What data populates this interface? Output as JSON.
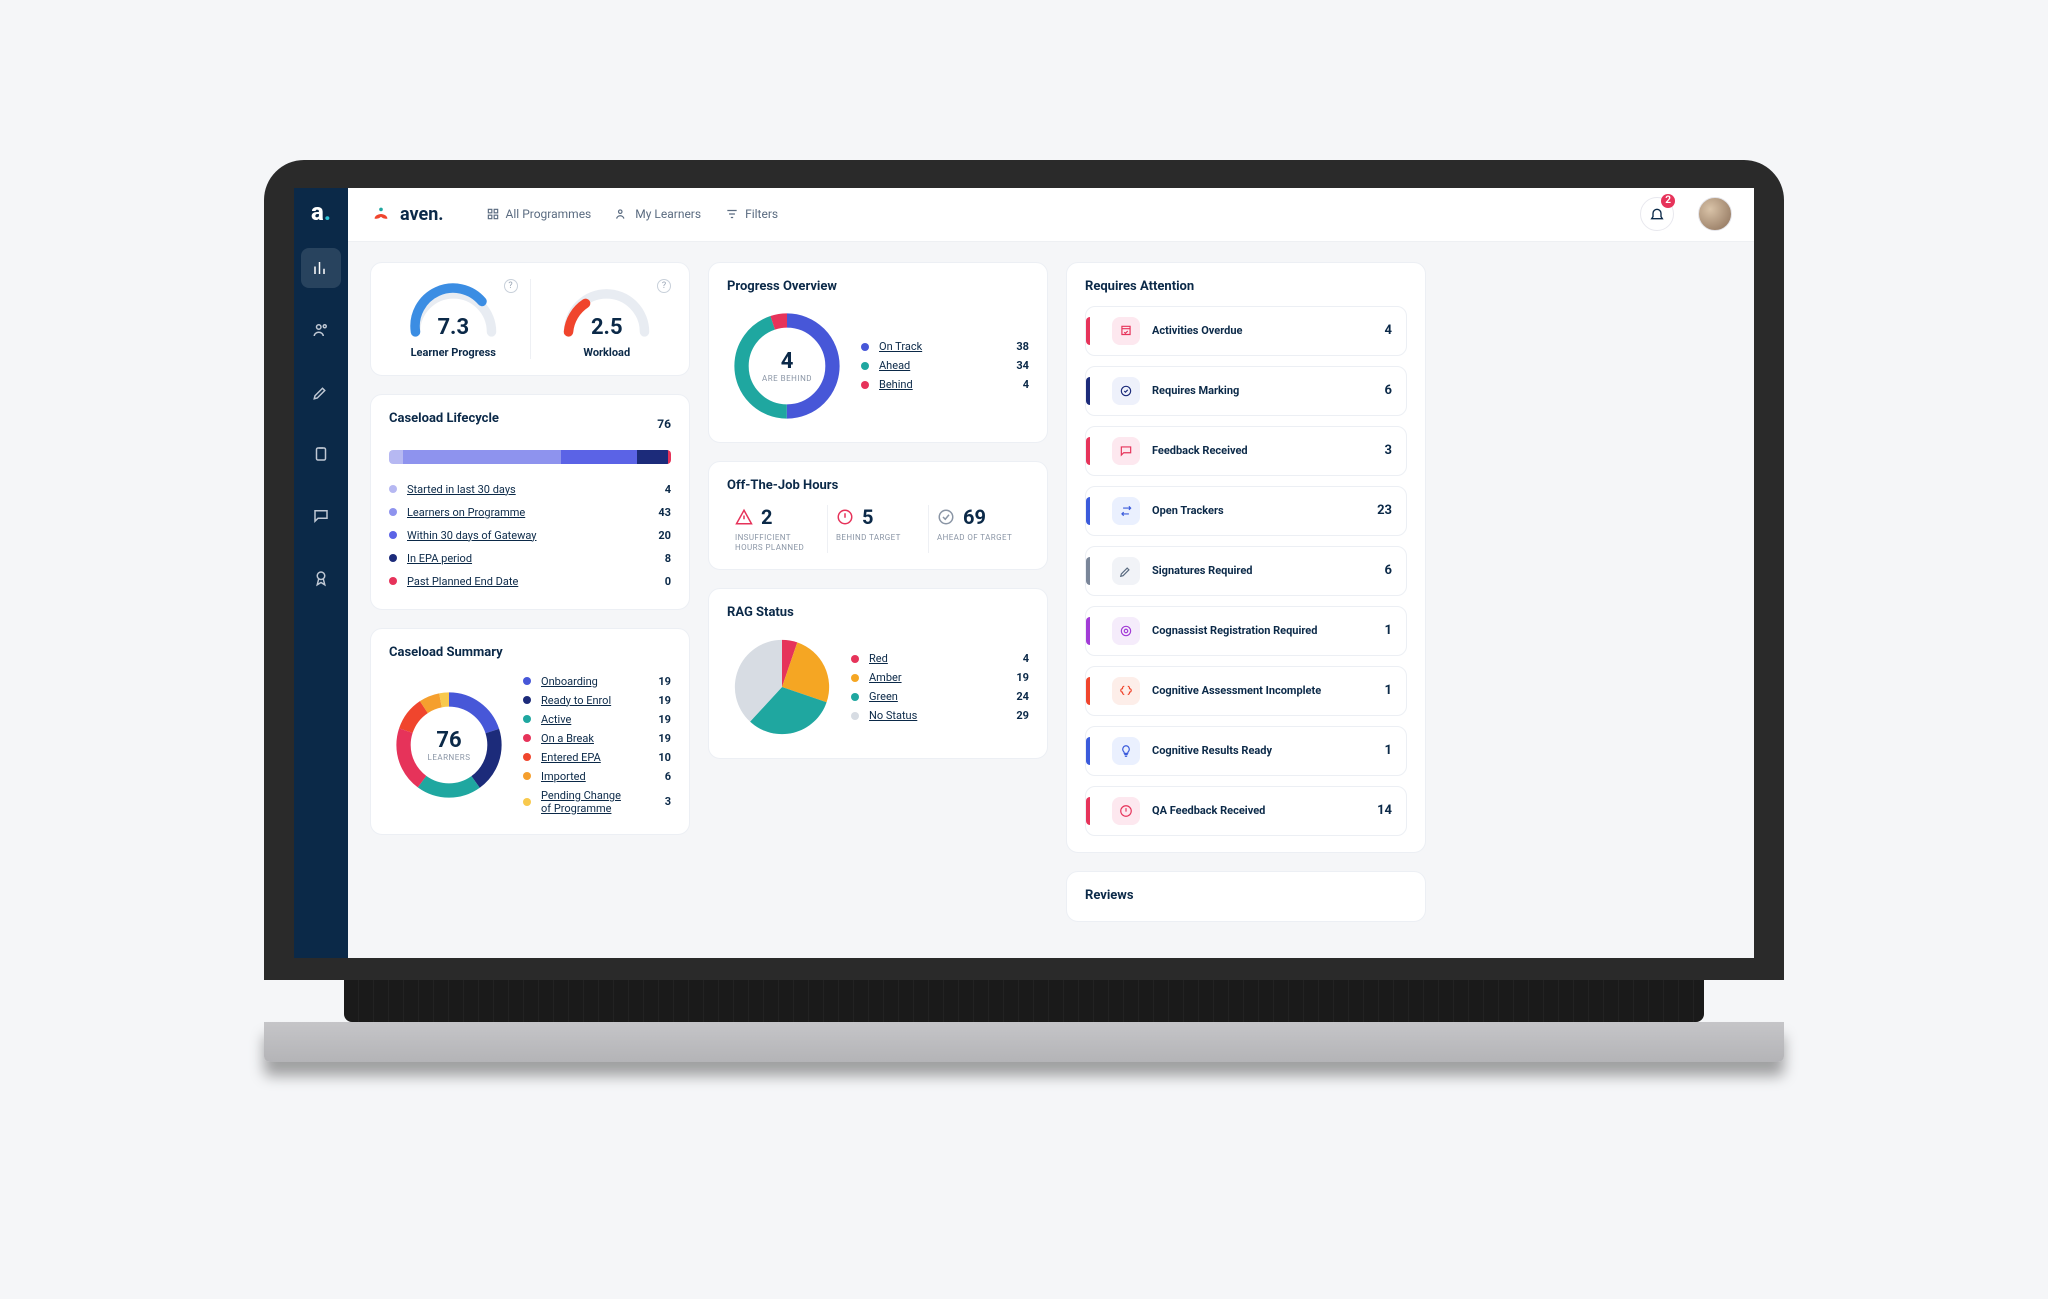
{
  "brand": "aven.",
  "header": {
    "all_programmes": "All Programmes",
    "my_learners": "My Learners",
    "filters": "Filters",
    "notification_count": "2"
  },
  "gauges": {
    "learner_progress": {
      "value": "7.3",
      "label": "Learner Progress"
    },
    "workload": {
      "value": "2.5",
      "label": "Workload"
    }
  },
  "lifecycle": {
    "title": "Caseload Lifecycle",
    "total": "76",
    "segments": [
      {
        "color": "#b6b8f2",
        "width": 5
      },
      {
        "color": "#8e93ee",
        "width": 56
      },
      {
        "color": "#5b63e6",
        "width": 27
      },
      {
        "color": "#1c2b7a",
        "width": 11
      },
      {
        "color": "#e6335a",
        "width": 1
      }
    ],
    "items": [
      {
        "label": "Started in last 30 days",
        "value": "4",
        "color": "#b6b8f2"
      },
      {
        "label": "Learners on Programme",
        "value": "43",
        "color": "#8e93ee"
      },
      {
        "label": "Within 30 days of Gateway",
        "value": "20",
        "color": "#5b63e6"
      },
      {
        "label": "In EPA period",
        "value": "8",
        "color": "#1c2b7a"
      },
      {
        "label": "Past Planned End Date",
        "value": "0",
        "color": "#e6335a"
      }
    ]
  },
  "summary": {
    "title": "Caseload Summary",
    "center_value": "76",
    "center_label": "LEARNERS",
    "items": [
      {
        "label": "Onboarding",
        "value": "19",
        "color": "#4757d8"
      },
      {
        "label": "Ready to Enrol",
        "value": "19",
        "color": "#1c2b7a"
      },
      {
        "label": "Active",
        "value": "19",
        "color": "#1fa7a0"
      },
      {
        "label": "On a Break",
        "value": "19",
        "color": "#e6335a"
      },
      {
        "label": "Entered EPA",
        "value": "10",
        "color": "#f0452d"
      },
      {
        "label": "Imported",
        "value": "6",
        "color": "#f59f2e"
      },
      {
        "label": "Pending Change of Programme",
        "value": "3",
        "color": "#f8c94d"
      }
    ]
  },
  "progress": {
    "title": "Progress Overview",
    "center_value": "4",
    "center_label": "ARE BEHIND",
    "items": [
      {
        "label": "On Track",
        "value": "38",
        "color": "#4757d8"
      },
      {
        "label": "Ahead",
        "value": "34",
        "color": "#1fa7a0"
      },
      {
        "label": "Behind",
        "value": "4",
        "color": "#e6335a"
      }
    ]
  },
  "otj": {
    "title": "Off-The-Job Hours",
    "cols": [
      {
        "icon": "warn",
        "color": "#e6335a",
        "value": "2",
        "caption": "INSUFFICIENT HOURS PLANNED"
      },
      {
        "icon": "alert",
        "color": "#e6335a",
        "value": "5",
        "caption": "BEHIND TARGET"
      },
      {
        "icon": "check",
        "color": "#8a95a5",
        "value": "69",
        "caption": "AHEAD OF TARGET"
      }
    ]
  },
  "rag": {
    "title": "RAG Status",
    "items": [
      {
        "label": "Red",
        "value": "4",
        "color": "#e6335a"
      },
      {
        "label": "Amber",
        "value": "19",
        "color": "#f5a623"
      },
      {
        "label": "Green",
        "value": "24",
        "color": "#1fa7a0"
      },
      {
        "label": "No Status",
        "value": "29",
        "color": "#d7dce3"
      }
    ]
  },
  "attention": {
    "title": "Requires Attention",
    "items": [
      {
        "label": "Activities Overdue",
        "value": "4",
        "accent": "#e6335a",
        "iconbg": "#fde8ef",
        "iconcolor": "#e6335a",
        "icon": "overdue"
      },
      {
        "label": "Requires Marking",
        "value": "6",
        "accent": "#1c2b7a",
        "iconbg": "#eef1fb",
        "iconcolor": "#1c2b7a",
        "icon": "check-circle"
      },
      {
        "label": "Feedback Received",
        "value": "3",
        "accent": "#e6335a",
        "iconbg": "#fde8ef",
        "iconcolor": "#e6335a",
        "icon": "chat"
      },
      {
        "label": "Open Trackers",
        "value": "23",
        "accent": "#3b5bdb",
        "iconbg": "#eaf0fe",
        "iconcolor": "#3b5bdb",
        "icon": "swap"
      },
      {
        "label": "Signatures Required",
        "value": "6",
        "accent": "#7a8699",
        "iconbg": "#f1f3f7",
        "iconcolor": "#5a6b80",
        "icon": "pen"
      },
      {
        "label": "Cognassist Registration Required",
        "value": "1",
        "accent": "#a23bd6",
        "iconbg": "#f5ecfb",
        "iconcolor": "#a23bd6",
        "icon": "target"
      },
      {
        "label": "Cognitive Assessment Incomplete",
        "value": "1",
        "accent": "#f0452d",
        "iconbg": "#fdeee9",
        "iconcolor": "#f0452d",
        "icon": "brain"
      },
      {
        "label": "Cognitive Results Ready",
        "value": "1",
        "accent": "#3b5bdb",
        "iconbg": "#eaf0fe",
        "iconcolor": "#3b5bdb",
        "icon": "bulb"
      },
      {
        "label": "QA Feedback Received",
        "value": "14",
        "accent": "#e6335a",
        "iconbg": "#fde8ef",
        "iconcolor": "#e6335a",
        "icon": "alert"
      }
    ]
  },
  "reviews": {
    "title": "Reviews"
  },
  "chart_data": [
    {
      "type": "gauge",
      "id": "learner_progress",
      "value": 7.3,
      "range": [
        0,
        10
      ],
      "title": "Learner Progress"
    },
    {
      "type": "gauge",
      "id": "workload",
      "value": 2.5,
      "range": [
        0,
        10
      ],
      "title": "Workload"
    },
    {
      "type": "bar",
      "id": "caseload_lifecycle_stacked",
      "categories": [
        "Started in last 30 days",
        "Learners on Programme",
        "Within 30 days of Gateway",
        "In EPA period",
        "Past Planned End Date"
      ],
      "values": [
        4,
        43,
        20,
        8,
        0
      ],
      "title": "Caseload Lifecycle",
      "total": 76
    },
    {
      "type": "pie",
      "id": "caseload_summary_donut",
      "categories": [
        "Onboarding",
        "Ready to Enrol",
        "Active",
        "On a Break",
        "Entered EPA",
        "Imported",
        "Pending Change of Programme"
      ],
      "values": [
        19,
        19,
        19,
        19,
        10,
        6,
        3
      ],
      "title": "Caseload Summary",
      "total": 76
    },
    {
      "type": "pie",
      "id": "progress_overview_donut",
      "categories": [
        "On Track",
        "Ahead",
        "Behind"
      ],
      "values": [
        38,
        34,
        4
      ],
      "title": "Progress Overview"
    },
    {
      "type": "pie",
      "id": "rag_status_pie",
      "categories": [
        "Red",
        "Amber",
        "Green",
        "No Status"
      ],
      "values": [
        4,
        19,
        24,
        29
      ],
      "title": "RAG Status"
    }
  ]
}
